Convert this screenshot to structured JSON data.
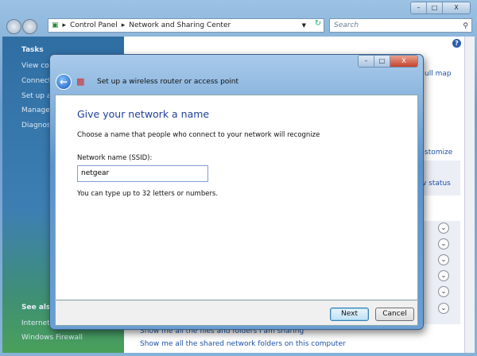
{
  "explorer": {
    "breadcrumb": [
      "Control Panel",
      "Network and Sharing Center"
    ],
    "search_placeholder": "Search",
    "sidebar": {
      "tasks_heading": "Tasks",
      "tasks": [
        "View con",
        "Connect",
        "Set up a",
        "Manage",
        "Diagnose"
      ],
      "see_also_heading": "See also",
      "see_also": [
        "Internet",
        "Windows Firewall"
      ]
    },
    "main": {
      "view_full_map": "ull map",
      "customize": "stomize",
      "view_status": "v status",
      "links": [
        "Show me all the files and folders I am sharing",
        "Show me all the shared network folders on this computer"
      ]
    }
  },
  "dialog": {
    "title": "Set up a wireless router or access point",
    "heading": "Give your network a name",
    "description": "Choose a name that people who connect to your network will recognize",
    "ssid_label": "Network name (SSID):",
    "ssid_value": "netgear",
    "hint": "You can type up to 32 letters or numbers.",
    "next_label": "Next",
    "cancel_label": "Cancel"
  }
}
